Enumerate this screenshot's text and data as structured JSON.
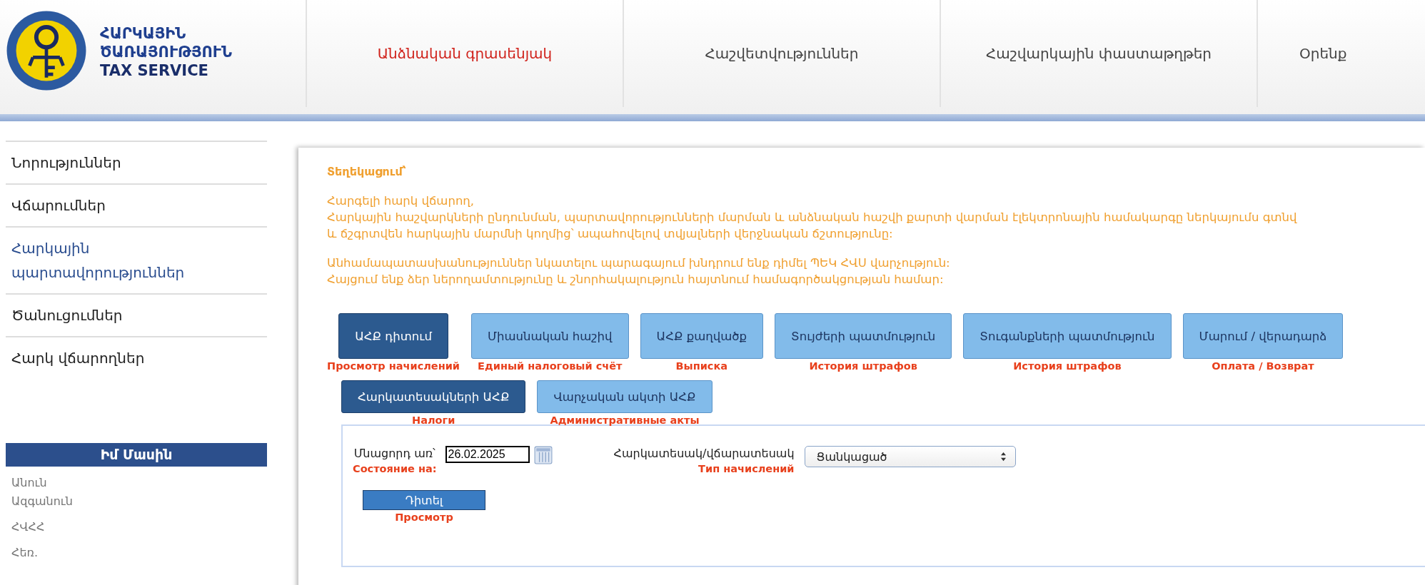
{
  "header": {
    "logo_lines": [
      "ՀԱՐԿԱՅԻՆ",
      "ԾԱՌԱՅՈՒԹՅՈՒՆ",
      "TAX SERVICE"
    ],
    "nav": [
      {
        "label": "Անձնական գրասենյակ",
        "selected": true
      },
      {
        "label": "Հաշվետվություններ",
        "selected": false
      },
      {
        "label": "Հաշվարկային փաստաթղթեր",
        "selected": false
      },
      {
        "label": "Օրենք",
        "selected": false
      }
    ]
  },
  "sidebar": {
    "items": [
      {
        "label": "Նորություններ",
        "selected": false
      },
      {
        "label": "Վճարումներ",
        "selected": false
      },
      {
        "label": "Հարկային պարտավորություններ",
        "selected": true
      },
      {
        "label": "Ծանուցումներ",
        "selected": false
      },
      {
        "label": "Հարկ վճարողներ",
        "selected": false
      }
    ],
    "about": {
      "title": "Իմ Մասին",
      "fields": [
        [
          "Անուն",
          "Ազգանուն"
        ],
        [
          "ՀՎՀՀ"
        ],
        [
          "Հեռ."
        ]
      ]
    }
  },
  "notice": {
    "title": "Տեղեկացում՝",
    "paragraphs": [
      [
        "Հարգելի հարկ վճարող,",
        "Հարկային հաշվարկների ընդունման, պարտավորությունների մարման և անձնական հաշվի քարտի վարման էլեկտրոնային համակարգը ներկայումս գտնվ",
        "և ճշգրտվեն հարկային մարմնի կողմից՝ ապահովելով տվյալների վերջնական ճշտությունը:"
      ],
      [
        "Անհամապատասխանություններ նկատելու պարագայում խնդրում ենք դիմել ՊԵԿ ՀՎՍ վարչություն:",
        "Հայցում ենք ձեր ներողամտությունը և շնորհակալություն հայտնում համագործակցության համար:"
      ]
    ]
  },
  "buttons": [
    {
      "label": "ԱՀՔ դիտում",
      "caption": "Просмотр начислений",
      "selected": true
    },
    {
      "label": "Միասնական հաշիվ",
      "caption": "Единый налоговый счёт",
      "selected": false
    },
    {
      "label": "ԱՀՔ քաղվածք",
      "caption": "Выписка",
      "selected": false
    },
    {
      "label": "Տույժերի պատմություն",
      "caption": "История штрафов",
      "selected": false
    },
    {
      "label": "Տուգանքների պատմություն",
      "caption": "История штрафов",
      "selected": false
    },
    {
      "label": "Մարում / վերադարձ",
      "caption": "Оплата / Возврат",
      "selected": false
    }
  ],
  "subtabs": [
    {
      "label": "Հարկատեսակների ԱՀՔ",
      "caption": "Налоги",
      "selected": true
    },
    {
      "label": "Վարչական ակտի ԱՀՔ",
      "caption": "Административные акты",
      "selected": false
    }
  ],
  "form": {
    "date_label": "Մնացորդ առ՝",
    "date_caption": "Состояние на:",
    "date_value": "26.02.2025",
    "type_label": "Հարկատեսակ/վճարատեսակ",
    "type_caption": "Тип начислений",
    "type_value": "Ցանկացած",
    "view_button": "Դիտել",
    "view_caption": "Просмотр"
  }
}
